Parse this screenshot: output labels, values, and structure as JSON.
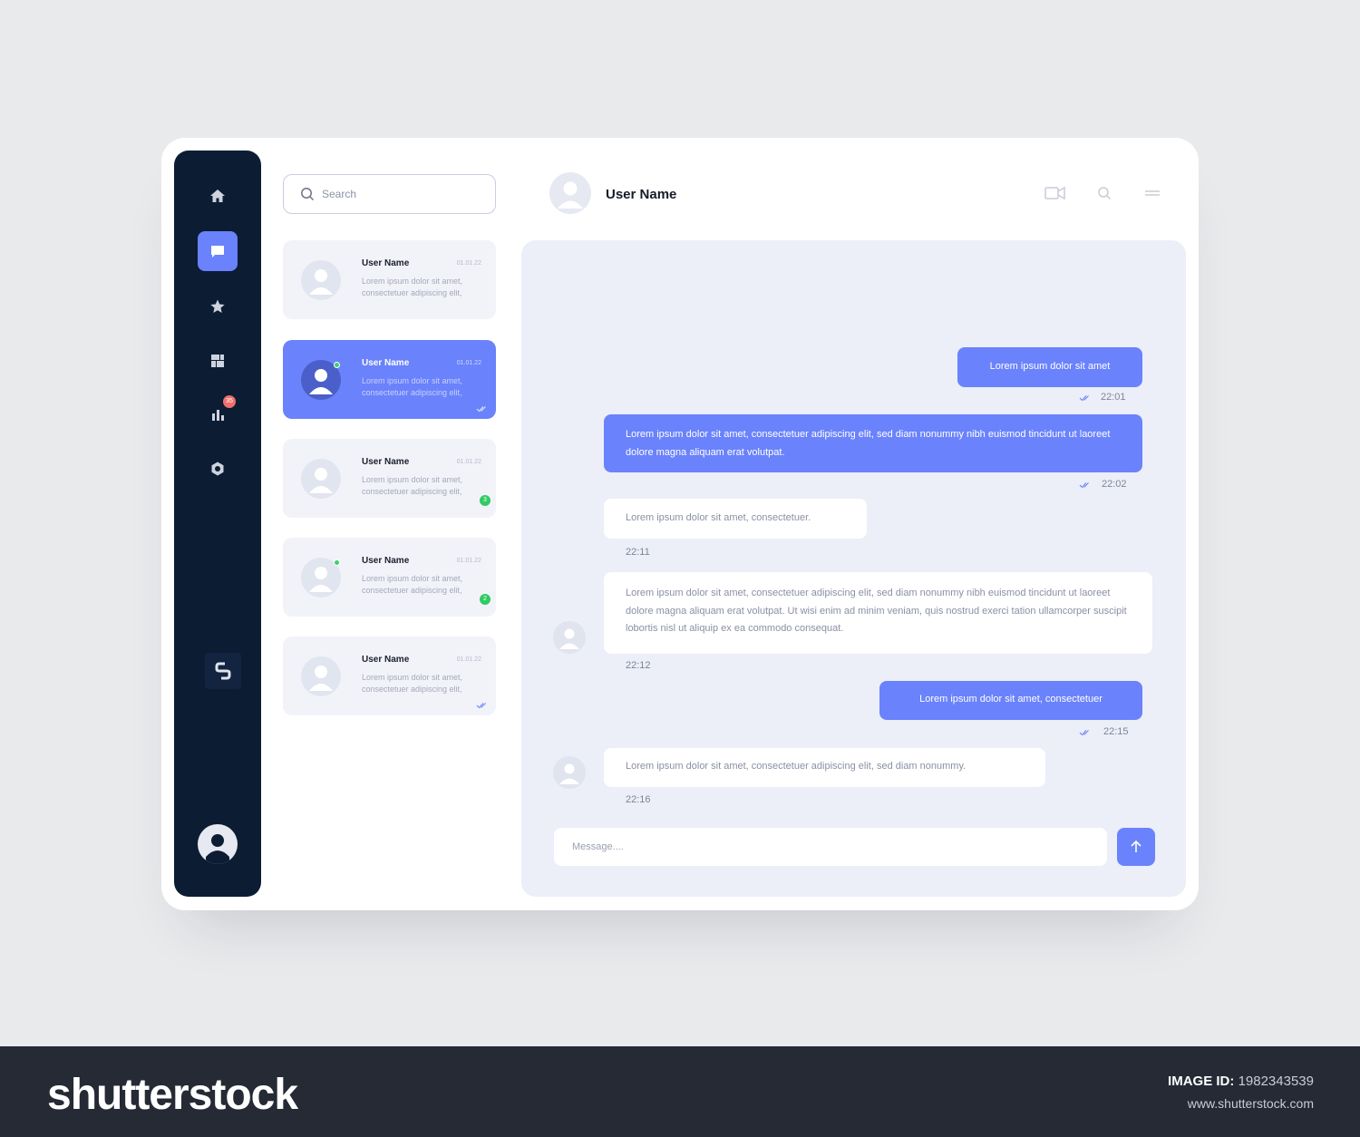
{
  "sidebar": {
    "nav": [
      {
        "icon": "home-icon",
        "active": false
      },
      {
        "icon": "chat-icon",
        "active": true
      },
      {
        "icon": "star-icon",
        "active": false
      },
      {
        "icon": "dashboard-icon",
        "active": false
      },
      {
        "icon": "stats-icon",
        "active": false,
        "badge": "35"
      },
      {
        "icon": "settings-icon",
        "active": false
      }
    ],
    "brand_icon": "brand-mark-icon",
    "profile_icon": "user-avatar-icon"
  },
  "search": {
    "placeholder": "Search"
  },
  "conversations": [
    {
      "name": "User Name",
      "date": "01.01.22",
      "preview": "Lorem ipsum dolor sit amet, consectetuer adipiscing elit,",
      "active": false,
      "online": false
    },
    {
      "name": "User Name",
      "date": "01.01.22",
      "preview": "Lorem ipsum dolor sit amet, consectetuer adipiscing elit,",
      "active": true,
      "online": true,
      "read": true
    },
    {
      "name": "User Name",
      "date": "01.01.22",
      "preview": "Lorem ipsum dolor sit amet, consectetuer adipiscing elit,",
      "active": false,
      "online": false,
      "unread": "3"
    },
    {
      "name": "User Name",
      "date": "01.01.22",
      "preview": "Lorem ipsum dolor sit amet, consectetuer adipiscing elit,",
      "active": false,
      "online": true,
      "unread": "2"
    },
    {
      "name": "User Name",
      "date": "01.01.22",
      "preview": "Lorem ipsum dolor sit amet, consectetuer adipiscing elit,",
      "active": false,
      "online": false,
      "read": true
    }
  ],
  "chat": {
    "contact_name": "User Name",
    "header_icons": [
      "video-icon",
      "search-icon",
      "menu-icon"
    ],
    "messages": [
      {
        "dir": "out",
        "text": "Lorem ipsum dolor sit amet",
        "time": "22:01",
        "read": true
      },
      {
        "dir": "out",
        "text": "Lorem ipsum dolor sit amet, consectetuer adipiscing elit, sed diam nonummy nibh euismod tincidunt ut laoreet dolore magna aliquam erat volutpat.",
        "time": "22:02",
        "read": true
      },
      {
        "dir": "in",
        "text": "Lorem ipsum dolor sit amet, consectetuer.",
        "time": "22:11"
      },
      {
        "dir": "in",
        "text": "Lorem ipsum dolor sit amet, consectetuer adipiscing elit, sed diam nonummy nibh euismod tincidunt ut laoreet dolore magna aliquam erat volutpat. Ut wisi enim ad minim veniam, quis nostrud exerci tation ullamcorper suscipit lobortis nisl ut aliquip ex ea commodo consequat.",
        "time": "22:12",
        "avatar": true
      },
      {
        "dir": "out",
        "text": "Lorem ipsum dolor sit amet, consectetuer",
        "time": "22:15",
        "read": true
      },
      {
        "dir": "in",
        "text": "Lorem ipsum dolor sit amet, consectetuer adipiscing elit, sed diam nonummy.",
        "time": "22:16",
        "avatar": true
      }
    ],
    "composer_placeholder": "Message....",
    "send_icon": "arrow-up-icon"
  },
  "footer": {
    "logo": "shutterstock",
    "image_id_label": "IMAGE ID:",
    "image_id": "1982343539",
    "site": "www.shutterstock.com"
  },
  "colors": {
    "accent": "#6a82fb",
    "sidebar": "#0c1c33",
    "panel": "#eceef8",
    "online": "#3bd16f",
    "alert": "#ef6f6c"
  }
}
